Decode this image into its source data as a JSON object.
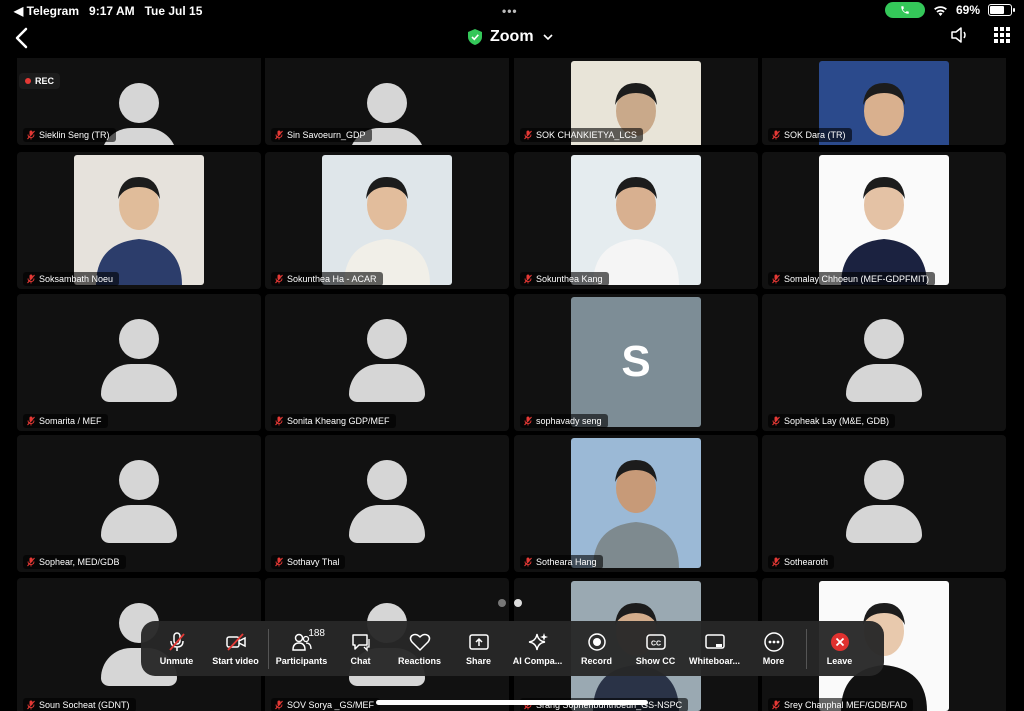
{
  "status": {
    "back_app": "◀ Telegram",
    "time": "9:17 AM",
    "date": "Tue Jul 15",
    "battery": "69%",
    "battery_level": 0.69
  },
  "header": {
    "title": "Zoom"
  },
  "recording": {
    "label": "REC"
  },
  "tiles": [
    {
      "name": "Sieklin Seng (TR)",
      "type": "avatar"
    },
    {
      "name": "Sin Savoeurn_GDP",
      "type": "avatar"
    },
    {
      "name": "SOK CHANKIETYA_LCS",
      "type": "photo"
    },
    {
      "name": "SOK Dara (TR)",
      "type": "photo"
    },
    {
      "name": "Soksambath Noeu",
      "type": "photo"
    },
    {
      "name": "Sokunthea Ha - ACAR",
      "type": "photo"
    },
    {
      "name": "Sokunthea Kang",
      "type": "photo"
    },
    {
      "name": "Somalay Chhoeun (MEF-GDPFMIT)",
      "type": "photo"
    },
    {
      "name": "Somarita / MEF",
      "type": "avatar"
    },
    {
      "name": "Sonita Kheang GDP/MEF",
      "type": "avatar"
    },
    {
      "name": "sophavady seng",
      "type": "letter",
      "letter": "S"
    },
    {
      "name": "Sopheak Lay (M&E, GDB)",
      "type": "avatar"
    },
    {
      "name": "Sophear, MED/GDB",
      "type": "avatar"
    },
    {
      "name": "Sothavy Thal",
      "type": "avatar"
    },
    {
      "name": "Sotheara Hang",
      "type": "photo"
    },
    {
      "name": "Sothearoth",
      "type": "avatar"
    },
    {
      "name": "Soun Socheat (GDNT)",
      "type": "avatar"
    },
    {
      "name": "SOV Sorya _GS/MEF",
      "type": "avatar"
    },
    {
      "name": "Srang Sophenbunthoeun_GS-NSPC",
      "type": "photo"
    },
    {
      "name": "Srey Chanphal MEF/GDB/FAD",
      "type": "photo"
    }
  ],
  "toolbar": {
    "unmute": "Unmute",
    "start_video": "Start video",
    "participants": "Participants",
    "participants_count": "188",
    "chat": "Chat",
    "reactions": "Reactions",
    "share": "Share",
    "ai_companion": "AI Compa...",
    "record": "Record",
    "show_cc": "Show CC",
    "whiteboard": "Whiteboar...",
    "more": "More",
    "leave": "Leave"
  },
  "colors": {
    "accent_green": "#34c759",
    "muted_red": "#e53935",
    "leave_red": "#e0312f"
  }
}
